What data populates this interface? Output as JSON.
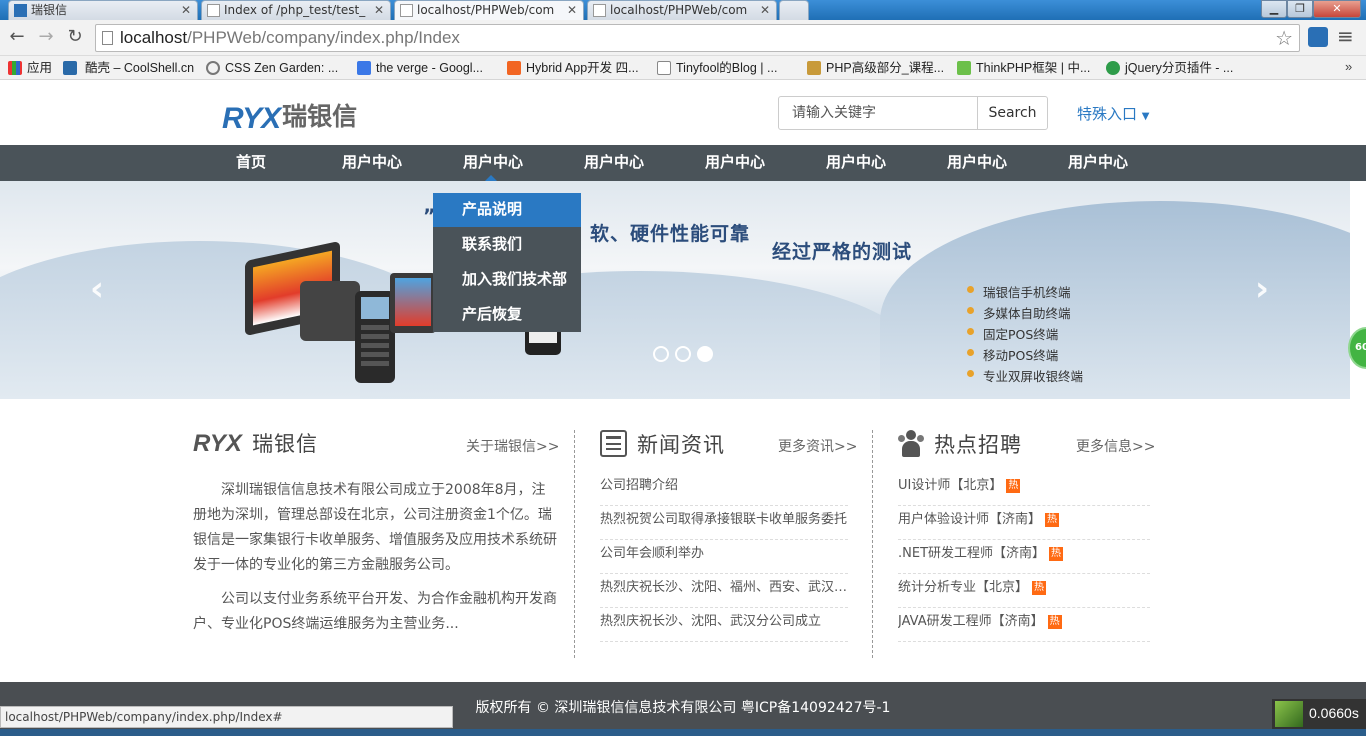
{
  "browser": {
    "tabs": [
      {
        "title": "瑞银信"
      },
      {
        "title": "Index of /php_test/test_"
      },
      {
        "title": "localhost/PHPWeb/com"
      },
      {
        "title": "localhost/PHPWeb/com"
      }
    ],
    "url_host": "localhost",
    "url_path": "/PHPWeb/company/index.php/Index",
    "bookmarks": [
      {
        "label": "应用",
        "color": "#4a8a3c"
      },
      {
        "label": "酷壳 – CoolShell.cn",
        "color": "#2a6aa8"
      },
      {
        "label": "CSS Zen Garden: ...",
        "color": "#777777"
      },
      {
        "label": "the verge - Googl...",
        "color": "#3b78e7"
      },
      {
        "label": "Hybrid App开发 四...",
        "color": "#f26522"
      },
      {
        "label": "Tinyfool的Blog | ...",
        "color": "#ffffff"
      },
      {
        "label": "PHP高级部分_课程...",
        "color": "#c89a3a"
      },
      {
        "label": "ThinkPHP框架 | 中...",
        "color": "#6cc04a"
      },
      {
        "label": "jQuery分页插件 - ...",
        "color": "#2e9c4a"
      }
    ],
    "status_url": "localhost/PHPWeb/company/index.php/Index#",
    "timer": "0.0660s",
    "side_badge": "60"
  },
  "header": {
    "logo_mark": "RYX",
    "logo_text": "瑞银信",
    "search_placeholder": "请输入关键字",
    "search_button": "Search",
    "special_entry": "特殊入口"
  },
  "nav": {
    "items": [
      "首页",
      "用户中心",
      "用户中心",
      "用户中心",
      "用户中心",
      "用户中心",
      "用户中心",
      "用户中心"
    ],
    "dropdown": [
      "产品说明",
      "联系我们",
      "加入我们技术部",
      "产后恢复"
    ]
  },
  "banner": {
    "slogan1": "软、硬件性能可靠",
    "slogan2": "经过严格的测试",
    "features": [
      "瑞银信手机终端",
      "多媒体自助终端",
      "固定POS终端",
      "移动POS终端",
      "专业双屏收银终端"
    ],
    "active_slide": 3,
    "slide_count": 3
  },
  "about": {
    "logo_mark": "RYX",
    "title": "瑞银信",
    "more": "关于瑞银信>>",
    "p1": "深圳瑞银信信息技术有限公司成立于2008年8月，注册地为深圳，管理总部设在北京，公司注册资金1个亿。瑞银信是一家集银行卡收单服务、增值服务及应用技术系统研发于一体的专业化的第三方金融服务公司。",
    "p2": "公司以支付业务系统平台开发、为合作金融机构开发商户、专业化POS终端运维服务为主营业务..."
  },
  "news": {
    "title": "新闻资讯",
    "more": "更多资讯>>",
    "items": [
      "公司招聘介绍",
      "热烈祝贺公司取得承接银联卡收单服务委托",
      "公司年会顺利举办",
      "热烈庆祝长沙、沈阳、福州、西安、武汉分公司成立",
      "热烈庆祝长沙、沈阳、武汉分公司成立"
    ]
  },
  "jobs": {
    "title": "热点招聘",
    "more": "更多信息>>",
    "hot_label": "热",
    "items": [
      "UI设计师【北京】",
      "用户体验设计师【济南】",
      ".NET研发工程师【济南】",
      "统计分析专业【北京】",
      "JAVA研发工程师【济南】"
    ]
  },
  "footer": {
    "copyright": "版权所有 © 深圳瑞银信信息技术有限公司 粤ICP备14092427号-1"
  }
}
